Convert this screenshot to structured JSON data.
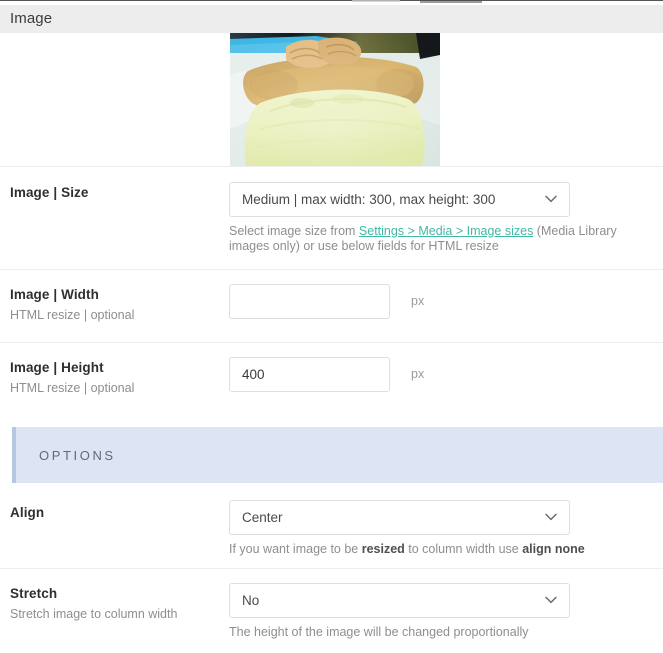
{
  "header": {
    "title": "Image"
  },
  "preview": {
    "alt_name": "massage-spa-photo"
  },
  "fields": {
    "size": {
      "label": "Image | Size",
      "sublabel": "",
      "value": "Medium | max width: 300, max height: 300",
      "help_prefix": "Select image size from ",
      "help_link": "Settings > Media > Image sizes",
      "help_suffix": " (Media Library images only) or use below fields for HTML resize"
    },
    "width": {
      "label": "Image | Width",
      "sublabel": "HTML resize | optional",
      "value": "",
      "placeholder": "",
      "unit": "px"
    },
    "height": {
      "label": "Image | Height",
      "sublabel": "HTML resize | optional",
      "value": "400",
      "placeholder": "",
      "unit": "px"
    },
    "align": {
      "label": "Align",
      "sublabel": "",
      "value": "Center",
      "help_a": "If you want image to be ",
      "help_b": "resized",
      "help_c": " to column width use ",
      "help_d": "align none"
    },
    "stretch": {
      "label": "Stretch",
      "sublabel": "Stretch image to column width",
      "value": "No",
      "help": "The height of the image will be changed proportionally"
    }
  },
  "sections": {
    "options_label": "OPTIONS"
  },
  "icons": {
    "chevron_down": "chevron-down-icon"
  },
  "colors": {
    "header_bg": "#ededed",
    "link": "#42b9a5",
    "options_bg": "#dde5f4",
    "options_border": "#b6c7e2",
    "border": "#dedede"
  }
}
